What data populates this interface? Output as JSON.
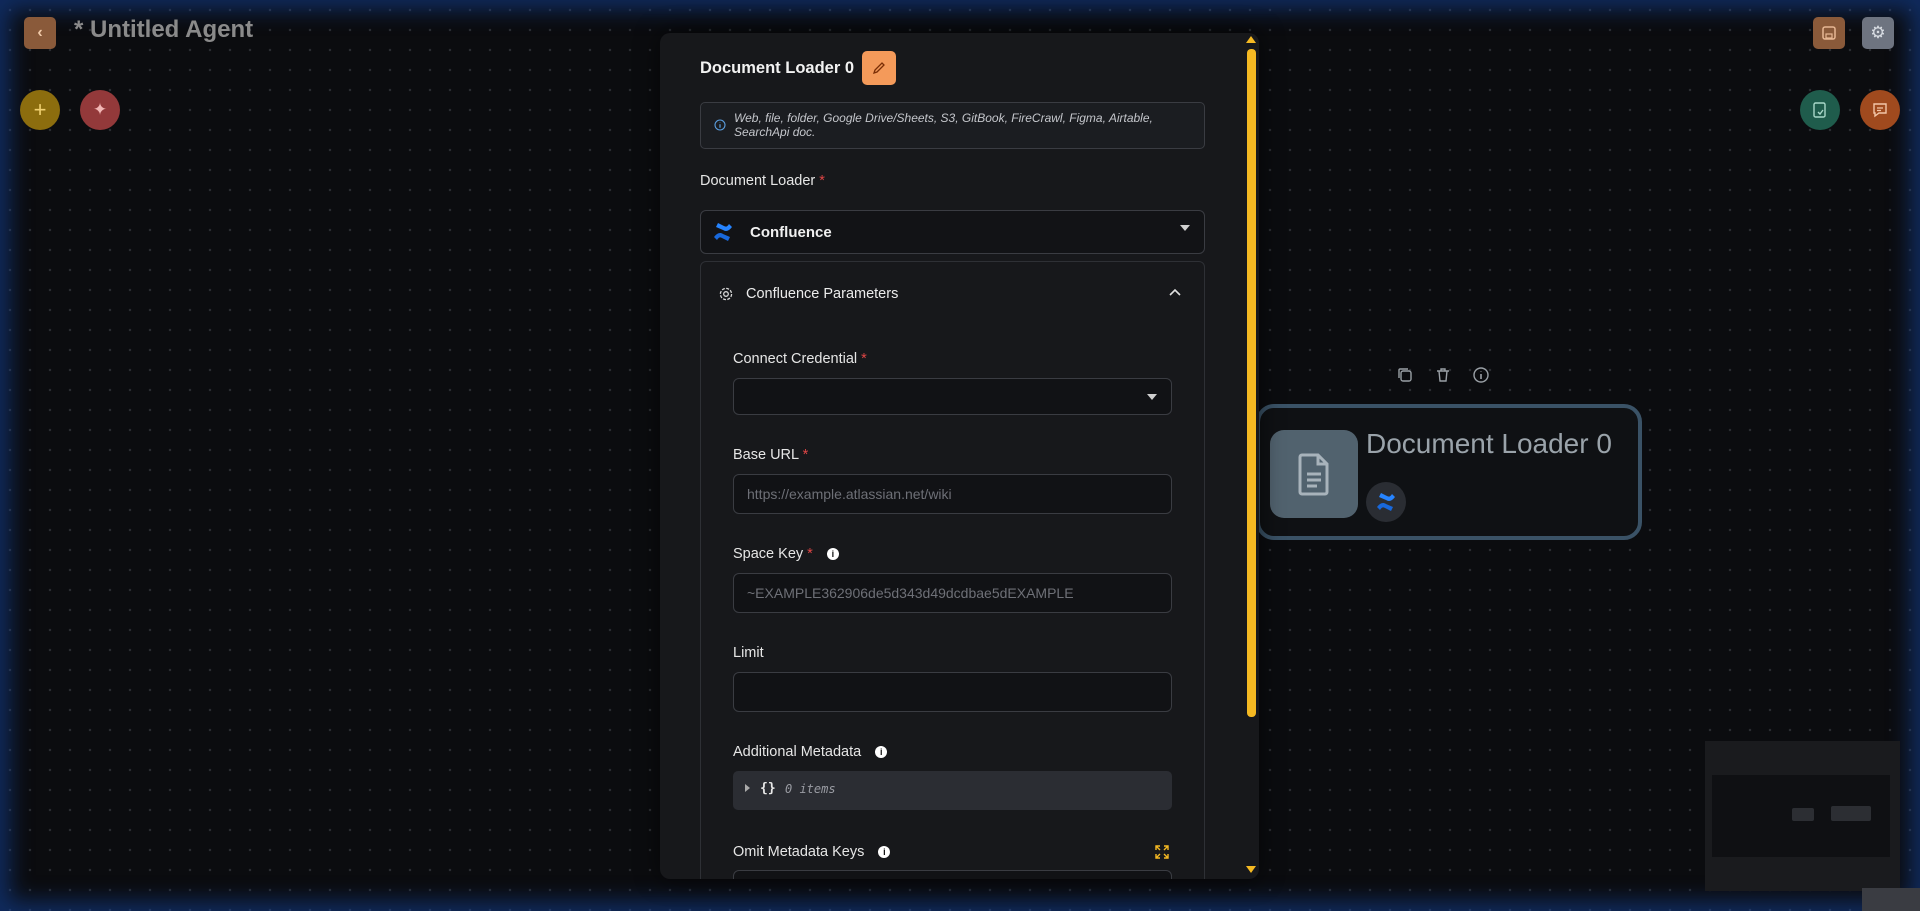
{
  "header": {
    "title": "* Untitled Agent",
    "back_icon": "chevron-left-icon",
    "save_icon": "save-icon",
    "settings_icon": "gear-icon"
  },
  "toolbar": {
    "add_icon": "plus-icon",
    "sparkle_icon": "sparkle-icon",
    "validate_icon": "checklist-icon",
    "chat_icon": "chat-icon"
  },
  "panel": {
    "node_name": "Document Loader 0",
    "edit_icon": "pencil-icon",
    "description": "Web, file, folder, Google Drive/Sheets, S3, GitBook, FireCrawl, Figma, Airtable, SearchApi doc.",
    "loader_label": "Document Loader",
    "loader_value": "Confluence",
    "params_title": "Confluence Parameters",
    "fields": {
      "credential_label": "Connect Credential",
      "credential_value": "",
      "base_url_label": "Base URL",
      "base_url_placeholder": "https://example.atlassian.net/wiki",
      "space_key_label": "Space Key",
      "space_key_placeholder": "~EXAMPLE362906de5d343d49dcdbae5dEXAMPLE",
      "limit_label": "Limit",
      "limit_value": "",
      "metadata_label": "Additional Metadata",
      "metadata_braces": "{}",
      "metadata_count": "0 items",
      "omit_label": "Omit Metadata Keys"
    }
  },
  "node": {
    "title": "Document Loader 0",
    "doc_icon": "document-icon",
    "copy_icon": "copy-icon",
    "delete_icon": "trash-icon",
    "info_icon": "info-icon"
  },
  "colors": {
    "accent_orange": "#f49a5a",
    "scroll_yellow": "#f5b922",
    "add_yellow": "#d4a017",
    "sparkle_red": "#d9534f",
    "teal": "#1f7a63",
    "chat_orange": "#d9652b",
    "confluence_blue": "#1868db"
  }
}
